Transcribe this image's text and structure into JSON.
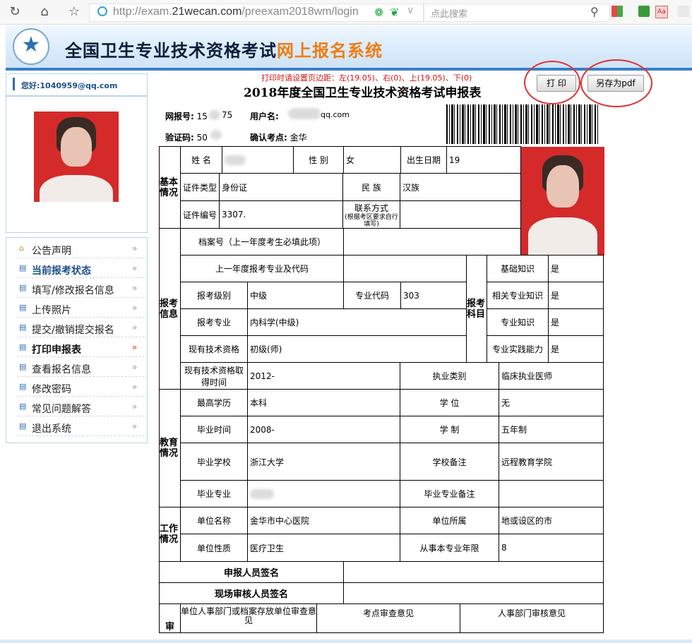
{
  "browser": {
    "url_prefix": "http://exam.",
    "url_domain": "21wecan.com",
    "url_path": "/preexam2018wm/login",
    "search_placeholder": "点此搜索",
    "icons": [
      "refresh-icon",
      "home-icon",
      "star-icon",
      "back-fwd"
    ]
  },
  "banner": {
    "title_main": "全国卫生专业技术资格考试",
    "title_highlight": "网上报名系统"
  },
  "sidebar": {
    "greeting": "您好:1040959@qq.com",
    "menu": [
      {
        "label": "公告声明",
        "icon": "home-icon"
      },
      {
        "label": "当前报考状态",
        "icon": "doc-icon"
      },
      {
        "label": "填写/修改报名信息",
        "icon": "doc-icon"
      },
      {
        "label": "上传照片",
        "icon": "doc-icon"
      },
      {
        "label": "提交/撤销提交报名",
        "icon": "doc-icon"
      },
      {
        "label": "打印申报表",
        "icon": "doc-icon"
      },
      {
        "label": "查看报名信息",
        "icon": "doc-icon"
      },
      {
        "label": "修改密码",
        "icon": "doc-icon"
      },
      {
        "label": "常见问题解答",
        "icon": "doc-icon"
      },
      {
        "label": "退出系统",
        "icon": "doc-icon"
      }
    ]
  },
  "form": {
    "note": "打印时请设置页边距：左(19.05)、右(0)、上(19.05)、下(0)",
    "title": "2018年度全国卫生专业技术资格考试申报表",
    "print_button": "打 印",
    "pdf_button": "另存为pdf",
    "meta": {
      "wbh_label": "网报号:",
      "wbh_value_a": "15",
      "wbh_value_b": "75",
      "user_label": "用户名:",
      "user_value": "qq.com",
      "code_label": "验证码:",
      "code_value": "50",
      "site_label": "确认考点:",
      "site_value": "金华"
    },
    "sections": {
      "basic": "基本情况",
      "report": "报考信息",
      "edu": "教育情况",
      "work": "工作情况",
      "review": "审"
    },
    "basic": {
      "name_label": "姓    名",
      "gender_label": "性    别",
      "gender_value": "女",
      "birth_label": "出生日期",
      "birth_value": "19",
      "idtype_label": "证件类型",
      "idtype_value": "身份证",
      "ethnic_label": "民    族",
      "ethnic_value": "汉族",
      "idno_label": "证件编号",
      "idno_value": "3307.",
      "contact_label": "联系方式",
      "contact_note": "(根据考区要求自行填写)"
    },
    "report": {
      "archive_label": "档案号（上一年度考生必填此项）",
      "lastyear_label": "上一年度报考专业及代码",
      "level_label": "报考级别",
      "level_value": "中级",
      "code_label": "专业代码",
      "code_value": "303",
      "major_label": "报考专业",
      "major_value": "内科学(中级)",
      "qual_label": "现有技术资格",
      "qual_value": "初级(师)",
      "qualtime_label": "现有技术资格取得时间",
      "qualtime_value": "2012-",
      "practice_label": "执业类别",
      "practice_value": "临床执业医师",
      "subjects_label": "报考科目",
      "subjects": [
        {
          "name": "基础知识",
          "value": "是"
        },
        {
          "name": "相关专业知识",
          "value": "是"
        },
        {
          "name": "专业知识",
          "value": "是"
        },
        {
          "name": "专业实践能力",
          "value": "是"
        }
      ]
    },
    "edu": {
      "degree_label": "最高学历",
      "degree_value": "本科",
      "xuewei_label": "学    位",
      "xuewei_value": "无",
      "gradtime_label": "毕业时间",
      "gradtime_value": "2008-",
      "xuezhi_label": "学    制",
      "xuezhi_value": "五年制",
      "school_label": "毕业学校",
      "school_value": "浙江大学",
      "schoolnote_label": "学校备注",
      "schoolnote_value": "远程教育学院",
      "major_label": "毕业专业",
      "majornote_label": "毕业专业备注"
    },
    "work": {
      "unit_label": "单位名称",
      "unit_value": "金华市中心医院",
      "region_label": "单位所属",
      "region_value": "地或设区的市",
      "nature_label": "单位性质",
      "nature_value": "医疗卫生",
      "years_label": "从事本专业年限",
      "years_value": "8"
    },
    "sign": {
      "applicant": "申报人员签名",
      "onsite": "现场审核人员签名",
      "hr": "单位人事部门或档案存放单位审查意见",
      "site": "考点审查意见",
      "dept": "人事部门审核意见"
    }
  }
}
